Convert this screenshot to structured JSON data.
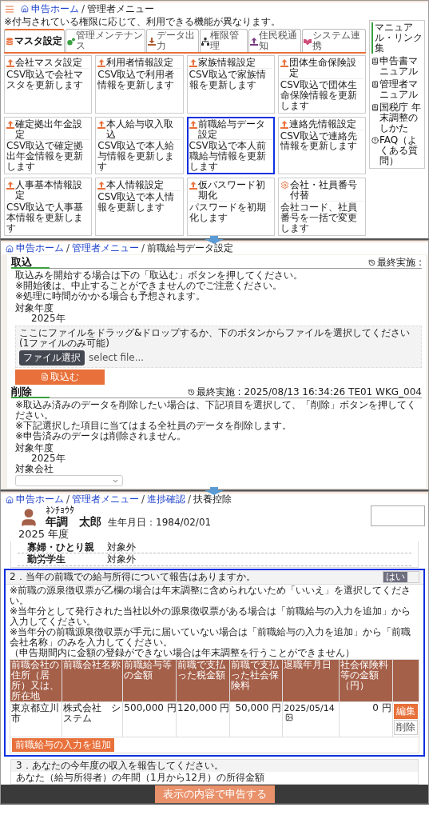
{
  "admin_menu": {
    "breadcrumb": {
      "separator": "/",
      "items": [
        {
          "label": "申告ホーム",
          "link": true
        },
        {
          "label": "管理者メニュー",
          "link": false
        }
      ]
    },
    "note": "※付与されている権限に応じて、利用できる機能が異なります。",
    "tabs": [
      {
        "label": "マスタ設定",
        "kind": "database",
        "color": "#e8703a",
        "selected": true
      },
      {
        "label": "管理メンテナンス",
        "kind": "gears",
        "color": "#3aa040",
        "selected": false
      },
      {
        "label": "データ出力",
        "kind": "download",
        "color": "#b05a30",
        "selected": false
      },
      {
        "label": "権限管理",
        "kind": "org",
        "color": "#333333",
        "selected": false
      },
      {
        "label": "住民税通知",
        "kind": "upload",
        "color": "#7a3a80",
        "selected": false
      },
      {
        "label": "システム連携",
        "kind": "handshake",
        "color": "#d0507a",
        "selected": false
      }
    ],
    "cards": [
      {
        "title": "会社マスタ設定",
        "description": "CSV取込で会社マスタを更新します",
        "kind": "upload",
        "highlighted": false
      },
      {
        "title": "利用者情報設定",
        "description": "CSV取込で利用者情報を更新します",
        "kind": "upload",
        "highlighted": false
      },
      {
        "title": "家族情報設定",
        "description": "CSV取込で家族情報を更新します",
        "kind": "upload",
        "highlighted": false
      },
      {
        "title": "団体生命保険設定",
        "description": "CSV取込で団体生命保険情報を更新します",
        "kind": "upload",
        "highlighted": false
      },
      {
        "title": "確定拠出年金設定",
        "description": "CSV取込で確定拠出年金情報を更新します",
        "kind": "upload",
        "highlighted": false
      },
      {
        "title": "本人給与収入取込",
        "description": "CSV取込で本人給与情報を更新します",
        "kind": "upload",
        "highlighted": false
      },
      {
        "title": "前職給与データ設定",
        "description": "CSV取込で本人前職給与情報を更新します",
        "kind": "upload",
        "highlighted": true
      },
      {
        "title": "連絡先情報設定",
        "description": "CSV取込で連絡先情報を更新します",
        "kind": "upload",
        "highlighted": false
      },
      {
        "title": "人事基本情報設定",
        "description": "CSV取込で人事基本情報を更新します",
        "kind": "upload",
        "highlighted": false
      },
      {
        "title": "本人情報設定",
        "description": "CSV取込で本人情報を更新します",
        "kind": "upload",
        "highlighted": false
      },
      {
        "title": "仮パスワード初期化",
        "description": "パスワードを初期化します",
        "kind": "upload",
        "highlighted": false
      },
      {
        "title": "会社・社員番号付替",
        "description": "会社コード、社員番号を一括で変更します",
        "kind": "gear",
        "highlighted": false
      }
    ],
    "links": {
      "title": "マニュアル・リンク集",
      "items": [
        {
          "label": "申告書マニュアル",
          "kind": "book"
        },
        {
          "label": "管理者マニュアル",
          "kind": "book"
        },
        {
          "label": "国税庁 年末調整のしかた",
          "kind": "book"
        },
        {
          "label": "FAQ（よくある質問）",
          "kind": "question"
        }
      ]
    }
  },
  "import_page": {
    "breadcrumb": {
      "separator": "/",
      "items": [
        {
          "label": "申告ホーム",
          "link": true
        },
        {
          "label": "管理者メニュー",
          "link": true
        },
        {
          "label": "前職給与データ設定",
          "link": false
        }
      ]
    },
    "import": {
      "title": "取込",
      "last_run": "最終実施 :",
      "lines": [
        "取込みを開始する場合は下の「取込む」ボタンを押してください。",
        "※開始後は、中止することができませんのでご注意ください。",
        "※処理に時間がかかる場合も予想されます。"
      ],
      "year_label": "対象年度",
      "year": "2025年",
      "drop_text": "ここにファイルをドラッグ&ドロップするか、下のボタンからファイルを選択してください(1ファイルのみ可能)",
      "file_button": "ファイル選択",
      "file_placeholder": "select file...",
      "submit": "取込む"
    },
    "delete": {
      "title": "削除",
      "last_run": "最終実施 : 2025/08/13 16:34:26 TE01 WKG_004",
      "lines": [
        "※取込み済みのデータを削除したい場合は、下記項目を選択して、「削除」ボタンを押してください。",
        "※下記選択した項目に当てはまる全社員のデータを削除します。",
        "※申告済みのデータは削除されません。"
      ],
      "year_label": "対象年度",
      "year": "2025年",
      "company_label": "対象会社"
    }
  },
  "employee_page": {
    "breadcrumb": {
      "separator": "/",
      "items": [
        {
          "label": "申告ホーム",
          "link": true
        },
        {
          "label": "管理者メニュー",
          "link": true
        },
        {
          "label": "進捗確認",
          "link": true
        },
        {
          "label": "扶養控除",
          "link": false
        }
      ]
    },
    "kana": "ﾈﾝﾁｮｳﾀ",
    "name": "年調　太郎",
    "birth": "生年月日：1984/02/01",
    "year": "2025 年度",
    "attributes": [
      {
        "label": "寡婦・ひとり親",
        "value": "対象外"
      },
      {
        "label": "勤労学生",
        "value": "対象外"
      }
    ],
    "question": {
      "title": "2．当年の前職での給与所得について報告はありますか。",
      "answer": "はい",
      "on": true
    },
    "notes": [
      "※前職の源泉徴収票が乙欄の場合は年末調整に含められないため「いいえ」を選択してください。",
      "※当年分として発行された当社以外の源泉徴収票がある場合は「前職給与の入力を追加」から入力してください。",
      "※当年分の前職源泉徴収票が手元に届いていない場合は「前職給与の入力を追加」から「前職会社名称」のみを入力してください。",
      "（申告期間内に金額の登録ができない場合は年末調整を行うことができません）"
    ],
    "columns": [
      "前職会社の住所（居所）又は、所在地",
      "前職会社名称",
      "前職給与等の金額",
      "前職で支払った税金額",
      "前職で支払った社会保険料",
      "退職年月日",
      "社会保険料等の金額（円）"
    ],
    "rows": [
      {
        "cells": [
          "東京都立川市",
          "株式会社　システム",
          "500,000 円",
          "120,000 円",
          "50,000 円",
          "2025/05/14",
          "0 円"
        ],
        "edit": "編集",
        "delete": "削除"
      }
    ],
    "add_button": "前職給与の入力を追加",
    "section3": {
      "title": "3．あなたの今年度の収入を報告してください。",
      "text": "あなた（給与所得者）の年間（1月から12月）の所得金額"
    },
    "submit": "表示の内容で申告する"
  }
}
